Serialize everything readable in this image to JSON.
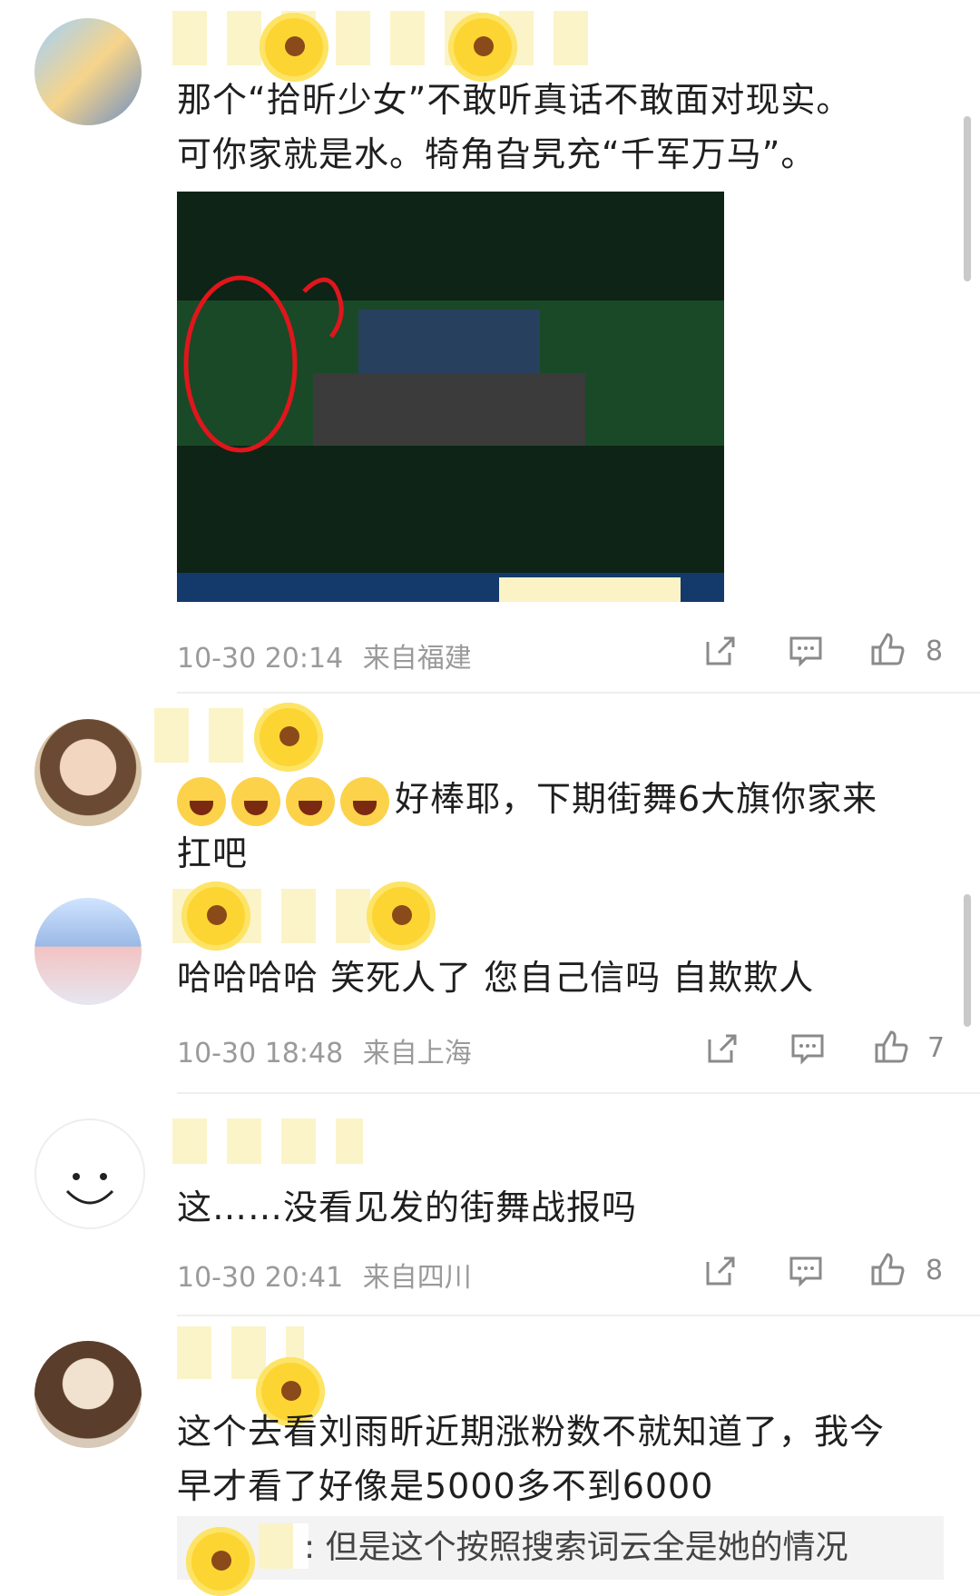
{
  "comments": [
    {
      "text_line1": "那个“拾昕少女”不敢听真话不敢面对现实。",
      "text_line2": "可你家就是水。犄角旮旯充“千军万马”。",
      "time": "10-30 20:14",
      "location": "来自福建",
      "likes": "8"
    },
    {
      "text_emoji_tail": "好棒耶，下期街舞6大旗你家来",
      "text_line2": "扛吧"
    },
    {
      "text": "哈哈哈哈 笑死人了 您自己信吗 自欺欺人",
      "time": "10-30 18:48",
      "location": "来自上海",
      "likes": "7"
    },
    {
      "text": "这……没看见发的街舞战报吗",
      "time": "10-30 20:41",
      "location": "来自四川",
      "likes": "8"
    },
    {
      "text_line1": "这个去看刘雨昕近期涨粉数不就知道了，我今",
      "text_line2": "早才看了好像是5000多不到6000",
      "reply_preview": ": 但是这个按照搜索词云全是她的情况"
    }
  ],
  "icons": {
    "share": "share-icon",
    "comment": "comment-icon",
    "like": "thumbs-up-icon"
  },
  "colors": {
    "meta_text": "#9a9a9a",
    "body_text": "#1f1f1f",
    "mask_yellow": "#fcd532"
  }
}
